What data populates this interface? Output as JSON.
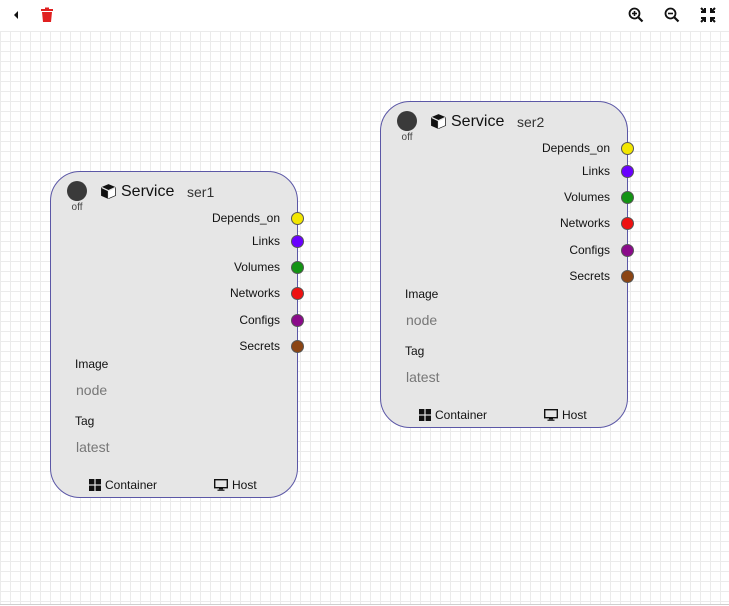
{
  "toolbar": {
    "back_icon": "caret-left-icon",
    "delete_icon": "trash-icon",
    "zoom_in_icon": "zoom-in-icon",
    "zoom_out_icon": "zoom-out-icon",
    "fit_icon": "compress-icon",
    "delete_color": "#e02020"
  },
  "nodes": [
    {
      "toggle_label": "off",
      "type_label": "Service",
      "name": "ser1",
      "ports": [
        {
          "label": "Depends_on",
          "color": "#f2e600"
        },
        {
          "label": "Links",
          "color": "#6a00ff"
        },
        {
          "label": "Volumes",
          "color": "#149414"
        },
        {
          "label": "Networks",
          "color": "#ee1111"
        },
        {
          "label": "Configs",
          "color": "#8a0a8a"
        },
        {
          "label": "Secrets",
          "color": "#8b4513"
        }
      ],
      "image_label": "Image",
      "image_placeholder": "node",
      "tag_label": "Tag",
      "tag_placeholder": "latest",
      "footer_container": "Container",
      "footer_host": "Host"
    },
    {
      "toggle_label": "off",
      "type_label": "Service",
      "name": "ser2",
      "ports": [
        {
          "label": "Depends_on",
          "color": "#f2e600"
        },
        {
          "label": "Links",
          "color": "#6a00ff"
        },
        {
          "label": "Volumes",
          "color": "#149414"
        },
        {
          "label": "Networks",
          "color": "#ee1111"
        },
        {
          "label": "Configs",
          "color": "#8a0a8a"
        },
        {
          "label": "Secrets",
          "color": "#8b4513"
        }
      ],
      "image_label": "Image",
      "image_placeholder": "node",
      "tag_label": "Tag",
      "tag_placeholder": "latest",
      "footer_container": "Container",
      "footer_host": "Host"
    }
  ],
  "colors": {
    "node_border": "#5b57a6",
    "node_fill": "#e6e6e6"
  }
}
